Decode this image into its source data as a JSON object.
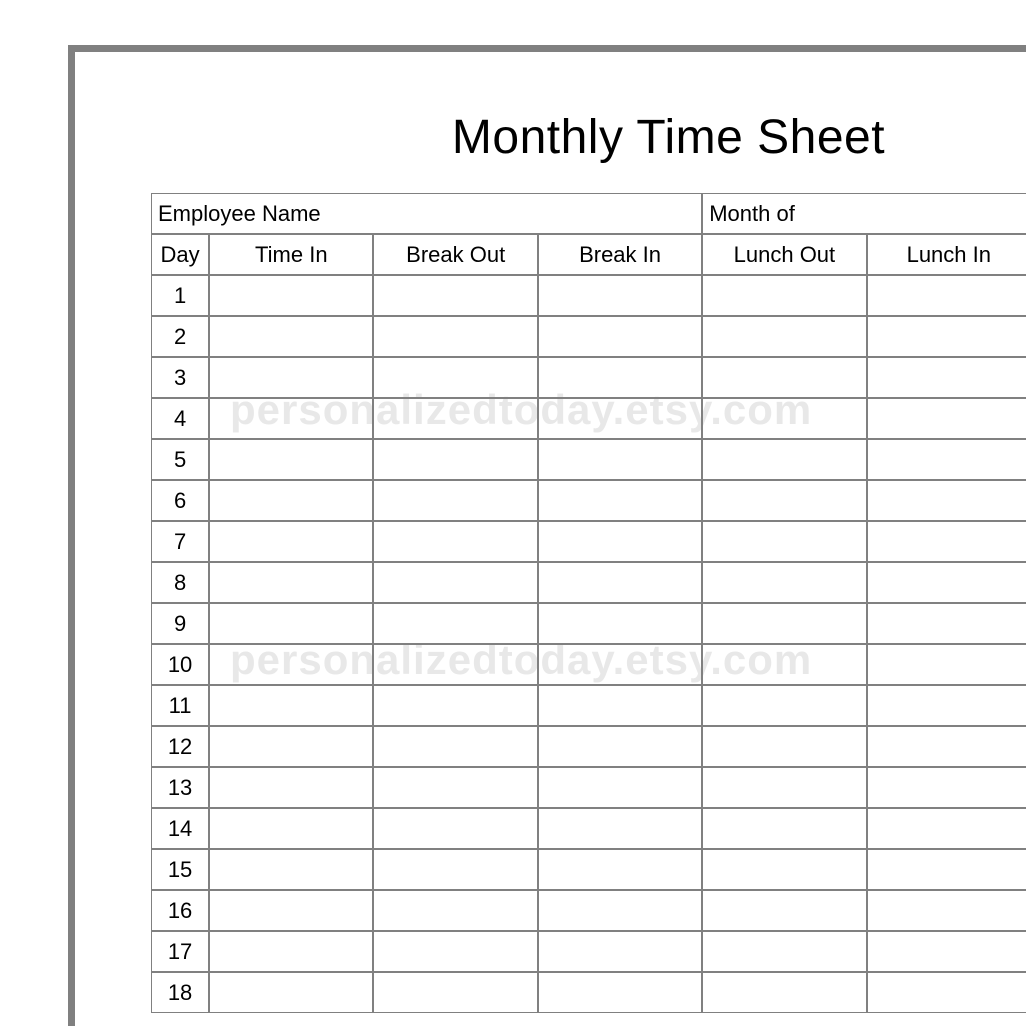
{
  "title": "Monthly Time Sheet",
  "header": {
    "employee_name_label": "Employee Name",
    "month_of_label": "Month of"
  },
  "columns": {
    "day": "Day",
    "time_in": "Time In",
    "break_out": "Break Out",
    "break_in": "Break In",
    "lunch_out": "Lunch Out",
    "lunch_in": "Lunch In"
  },
  "days": [
    "1",
    "2",
    "3",
    "4",
    "5",
    "6",
    "7",
    "8",
    "9",
    "10",
    "11",
    "12",
    "13",
    "14",
    "15",
    "16",
    "17",
    "18"
  ],
  "watermark": "personalizedtoday.etsy.com"
}
